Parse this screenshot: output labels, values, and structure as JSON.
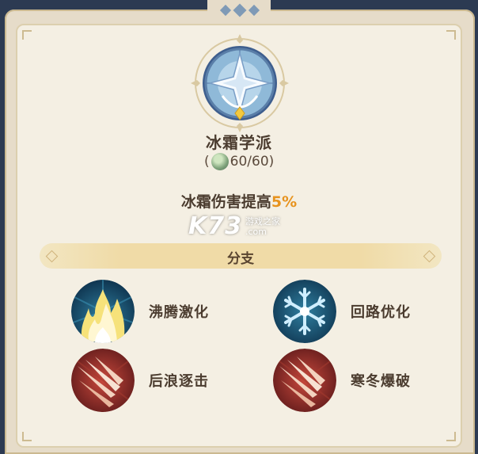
{
  "school": {
    "title": "冰霜学派",
    "cost_open": "(",
    "cost_value": "60/60",
    "cost_close": ")",
    "cost_icon": "ice-crystal-coin-icon",
    "emblem_icon": "frost-compass-emblem-icon"
  },
  "effect": {
    "text": "冰霜伤害提高",
    "value": "5%"
  },
  "watermark": {
    "logo": "K73",
    "site_cn": "游戏之家",
    "site_en": ".com"
  },
  "branch_header": "分支",
  "branches": [
    {
      "label": "沸腾激化",
      "icon": "flame-icon"
    },
    {
      "label": "回路优化",
      "icon": "snowflake-icon"
    },
    {
      "label": "后浪逐击",
      "icon": "claw-slash-icon"
    },
    {
      "label": "寒冬爆破",
      "icon": "claw-slash-icon"
    }
  ],
  "colors": {
    "highlight": "#e7931e",
    "text": "#4b3c2f",
    "panel": "#f4efe3",
    "banner": "#f0dba7"
  }
}
